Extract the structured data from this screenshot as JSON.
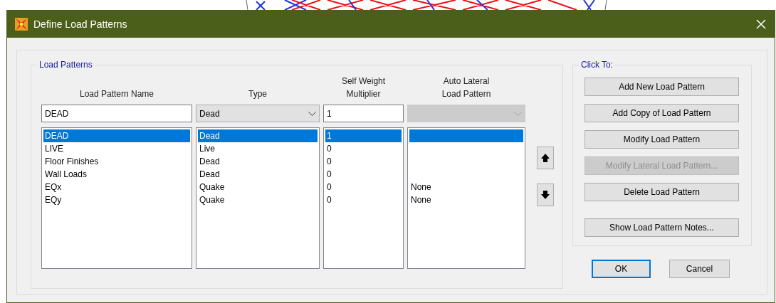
{
  "window": {
    "title": "Define Load Patterns"
  },
  "load_patterns": {
    "title": "Load Patterns",
    "columns": [
      "Load Pattern Name",
      "Type",
      "Self Weight Multiplier",
      "Auto Lateral Load Pattern"
    ],
    "editor": {
      "name": "DEAD",
      "type": "Dead",
      "multiplier": "1",
      "auto_lateral_disabled": true
    },
    "rows": [
      {
        "name": "DEAD",
        "type": "Dead",
        "multiplier": "1",
        "selected": true
      },
      {
        "name": "LIVE",
        "type": "Live",
        "multiplier": "0",
        "selected": false
      },
      {
        "name": "Floor Finishes",
        "type": "Dead",
        "multiplier": "0",
        "selected": false
      },
      {
        "name": "Wall Loads",
        "type": "Dead",
        "multiplier": "0",
        "selected": false
      },
      {
        "name": "EQx",
        "type": "Quake",
        "multiplier": "0",
        "auto_lateral": "None",
        "selected": false
      },
      {
        "name": "EQy",
        "type": "Quake",
        "multiplier": "0",
        "auto_lateral": "None",
        "selected": false
      }
    ]
  },
  "click_to": {
    "title": "Click To:",
    "buttons": [
      {
        "label": "Add New Load Pattern",
        "disabled": false
      },
      {
        "label": "Add Copy of Load Pattern",
        "disabled": false
      },
      {
        "label": "Modify Load Pattern",
        "disabled": false
      },
      {
        "label": "Modify Lateral Load Pattern...",
        "disabled": true
      },
      {
        "label": "Delete Load Pattern",
        "disabled": false
      },
      {
        "label": "Show Load Pattern Notes...",
        "disabled": false
      }
    ]
  },
  "dialog_buttons": [
    {
      "label": "OK",
      "default": true
    },
    {
      "label": "Cancel",
      "default": false
    }
  ]
}
